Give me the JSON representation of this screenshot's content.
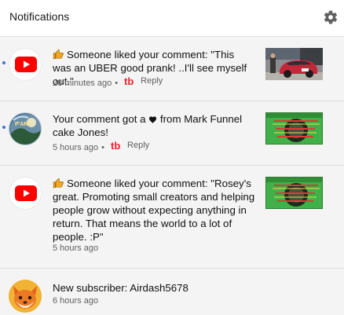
{
  "header": {
    "title": "Notifications",
    "settings_icon": "gear-icon"
  },
  "notifications": [
    {
      "unread": true,
      "avatar": "youtube-logo",
      "icon": "thumbs-up-icon",
      "text": "Someone liked your comment: \"This was an UBER good prank! ..I'll see myself out.\"",
      "time": "28 minutes ago",
      "reply_label": "Reply",
      "thumbnail": "car-thumbnail"
    },
    {
      "unread": true,
      "avatar": "channel-avatar",
      "avatar_text": "P'ART",
      "text_before": "Your comment got a",
      "heart_icon": "heart-icon",
      "text_after": "from Mark Funnel cake Jones!",
      "time": "5 hours ago",
      "reply_label": "Reply",
      "thumbnail": "green-thumbnail"
    },
    {
      "unread": false,
      "avatar": "youtube-logo",
      "icon": "thumbs-up-icon",
      "text": "Someone liked your comment: \"Rosey's great. Promoting small creators and helping people grow without expecting anything in return. That means the world to a lot of people. :P\"",
      "time": "5 hours ago",
      "thumbnail": "green-thumbnail"
    },
    {
      "unread": false,
      "avatar": "fox-avatar",
      "text": "New subscriber: Airdash5678",
      "time": "6 hours ago"
    }
  ],
  "colors": {
    "youtube_red": "#ff0000",
    "unread_dot": "#3d73d9",
    "thumb_green": "#39b54a"
  }
}
